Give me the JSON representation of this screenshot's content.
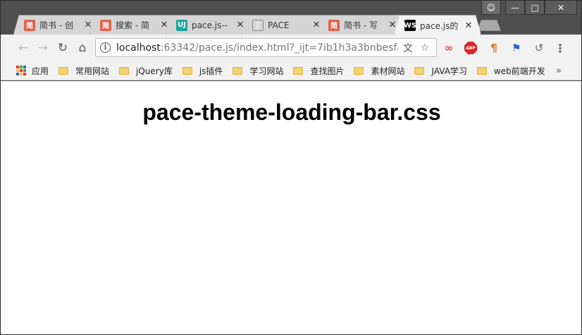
{
  "window": {
    "controls": {
      "user": "☺",
      "minimize": "—",
      "maximize": "□",
      "close": "✕"
    }
  },
  "tabs": [
    {
      "favicon": "简",
      "favicon_class": "fav-jianshu",
      "label": "简书 - 创",
      "active": false
    },
    {
      "favicon": "简",
      "favicon_class": "fav-sou",
      "label": "搜索 - 简",
      "active": false
    },
    {
      "favicon": "UJ",
      "favicon_class": "fav-uu",
      "label": "pace.js--",
      "active": false
    },
    {
      "favicon": "",
      "favicon_class": "fav-doc",
      "label": "PACE",
      "active": false
    },
    {
      "favicon": "简",
      "favicon_class": "fav-jianshu",
      "label": "简书 - 写",
      "active": false
    },
    {
      "favicon": "WS",
      "favicon_class": "fav-ws",
      "label": "pace.js的",
      "active": true
    }
  ],
  "toolbar": {
    "back_icon": "←",
    "forward_icon": "→",
    "reload_icon": "↻",
    "home_icon": "⌂",
    "info_icon": "i",
    "url_host": "localhost",
    "url_rest": ":63342/pace.js/index.html?_ijt=7ib1h3a3bnbesfa...",
    "translate_icon": "文",
    "star_icon": "☆",
    "extensions": {
      "infinity": "∞",
      "abp": "ABP",
      "paragraph": "¶",
      "image": "⚑",
      "sync": "↺",
      "menu": "⋮"
    }
  },
  "bookmarks": {
    "apps_label": "应用",
    "apps_colors": [
      "#e33",
      "#3a3",
      "#36c",
      "#fb3",
      "#e33",
      "#3a3",
      "#36c",
      "#fb3",
      "#e33"
    ],
    "items": [
      "常用网站",
      "jQuery库",
      "js插件",
      "学习网站",
      "查找图片",
      "素材网站",
      "JAVA学习",
      "web前端开发"
    ],
    "more": "»"
  },
  "page": {
    "heading": "pace-theme-loading-bar.css"
  }
}
